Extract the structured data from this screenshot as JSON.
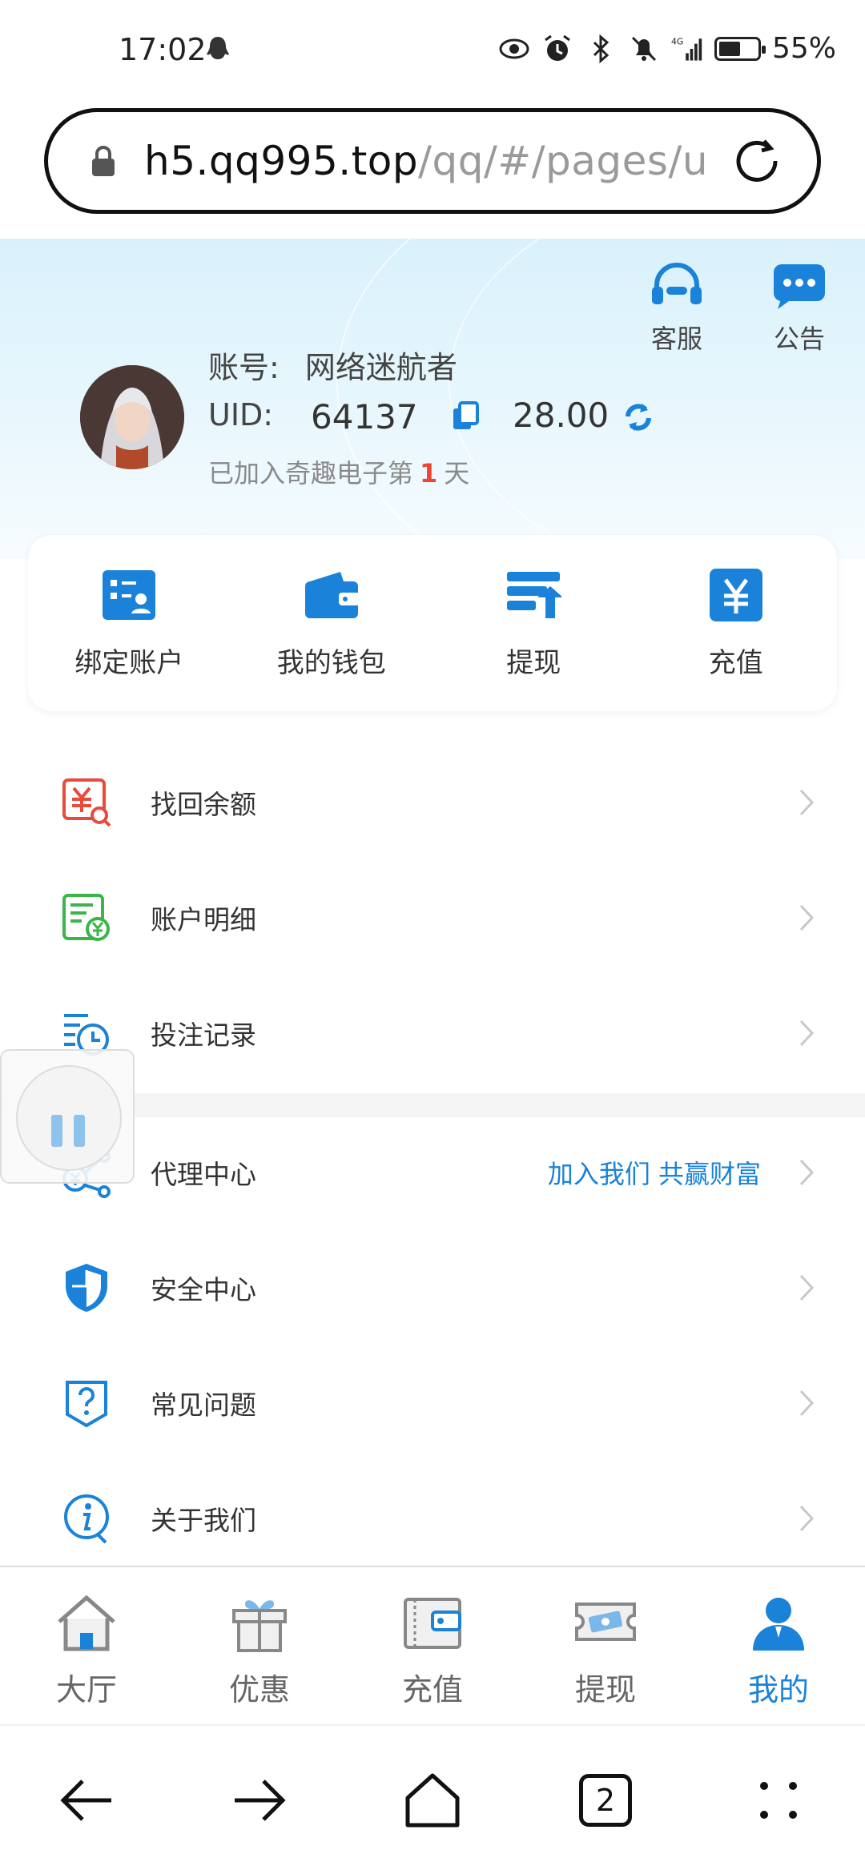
{
  "status_bar": {
    "time": "17:02",
    "battery_text": "55%",
    "battery_level": 0.55,
    "network": "4G"
  },
  "browser": {
    "url_host": "h5.qq995.top",
    "url_path": "/qq/#/pages/u",
    "tab_count": "2"
  },
  "header": {
    "customer_service_label": "客服",
    "notice_label": "公告",
    "account_label": "账号:",
    "account_name": "网络迷航者",
    "uid_label": "UID:",
    "uid_value": "64137",
    "balance": "28.00",
    "joined_prefix": "已加入奇趣电子第",
    "joined_days": "1",
    "joined_suffix": "天"
  },
  "quick_actions": [
    {
      "label": "绑定账户",
      "icon": "bind-account-icon"
    },
    {
      "label": "我的钱包",
      "icon": "wallet-icon"
    },
    {
      "label": "提现",
      "icon": "withdraw-icon"
    },
    {
      "label": "充值",
      "icon": "yen-recharge-icon"
    }
  ],
  "menu": [
    {
      "label": "找回余额",
      "icon": "recover-balance-icon",
      "color": "#e84a3c"
    },
    {
      "label": "账户明细",
      "icon": "account-detail-icon",
      "color": "#3bb54a"
    },
    {
      "label": "投注记录",
      "icon": "bet-record-icon",
      "color": "#1a82d8"
    },
    {
      "label": "代理中心",
      "icon": "agent-center-icon",
      "color": "#1a82d8",
      "extra": "加入我们 共赢财富"
    },
    {
      "label": "安全中心",
      "icon": "shield-icon",
      "color": "#1a82d8"
    },
    {
      "label": "常见问题",
      "icon": "question-icon",
      "color": "#1a82d8"
    },
    {
      "label": "关于我们",
      "icon": "info-icon",
      "color": "#1a82d8"
    }
  ],
  "bottom_nav": [
    {
      "label": "大厅",
      "icon": "home-icon",
      "active": false
    },
    {
      "label": "优惠",
      "icon": "gift-icon",
      "active": false
    },
    {
      "label": "充值",
      "icon": "wallet-icon",
      "active": false
    },
    {
      "label": "提现",
      "icon": "cash-icon",
      "active": false
    },
    {
      "label": "我的",
      "icon": "user-icon",
      "active": true
    }
  ],
  "colors": {
    "accent": "#1a82d8",
    "highlight_red": "#e43",
    "header_bg": "#d9f1fb"
  }
}
